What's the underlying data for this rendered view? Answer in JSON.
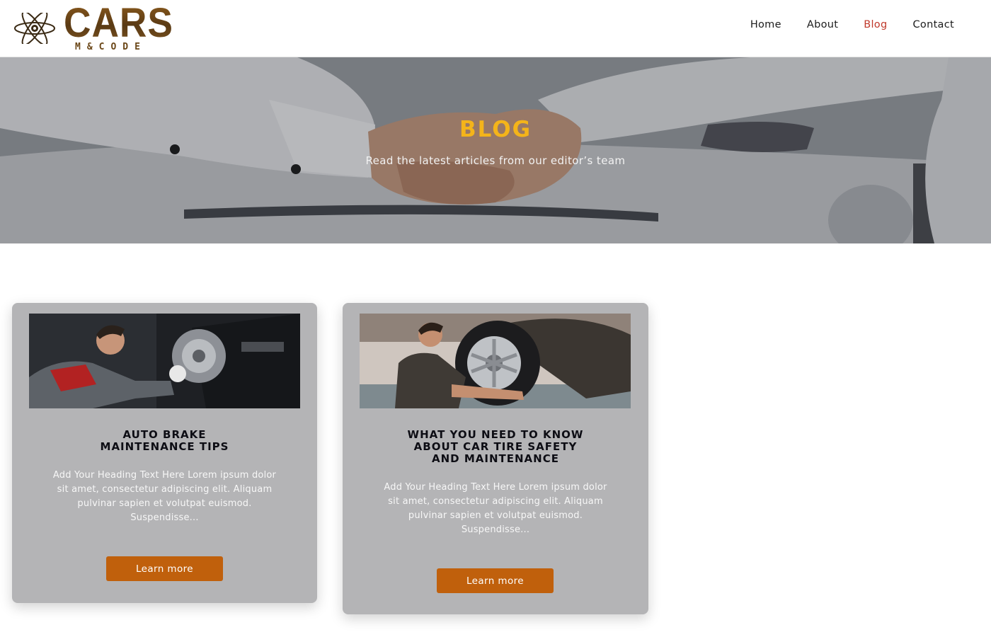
{
  "brand": {
    "wordmark": "CARS",
    "submark": "M&CODE",
    "logo_icon": "atom-icon",
    "colors": {
      "wordmark": "#6b4718"
    }
  },
  "nav": {
    "items": [
      {
        "label": "Home",
        "active": false
      },
      {
        "label": "About",
        "active": false
      },
      {
        "label": "Blog",
        "active": true
      },
      {
        "label": "Contact",
        "active": false
      }
    ],
    "active_color": "#c0392b"
  },
  "hero": {
    "title": "BLOG",
    "subtitle": "Read the latest articles from our editor’s team",
    "title_color": "#f4b41a"
  },
  "posts": [
    {
      "title_lines": [
        "AUTO BRAKE",
        "MAINTENANCE TIPS"
      ],
      "excerpt": "Add Your Heading Text Here Lorem ipsum dolor sit amet, consectetur adipiscing elit. Aliquam pulvinar sapien et volutpat euismod. Suspendisse...",
      "button_label": "Learn more",
      "image": "mechanic-brake-photo"
    },
    {
      "title_lines": [
        "WHAT YOU NEED TO KNOW",
        "ABOUT CAR TIRE SAFETY",
        "AND MAINTENANCE"
      ],
      "excerpt": "Add Your Heading Text Here Lorem ipsum dolor sit amet, consectetur adipiscing elit. Aliquam pulvinar sapien et volutpat euismod. Suspendisse...",
      "button_label": "Learn more",
      "image": "mechanic-tire-photo"
    }
  ],
  "colors": {
    "card_bg": "#b4b4b6",
    "button_bg": "#c0600c"
  }
}
